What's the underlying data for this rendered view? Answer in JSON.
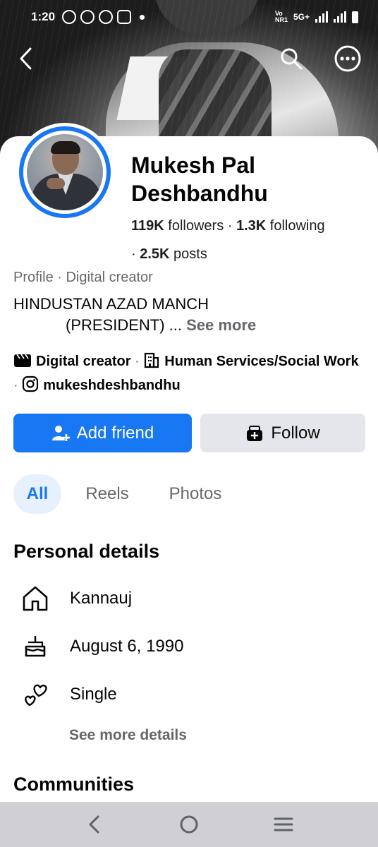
{
  "status_bar": {
    "time": "1:20",
    "network": "5G+"
  },
  "profile": {
    "name_line1": "Mukesh Pal",
    "name_line2": "Deshbandhu",
    "followers_count": "119K",
    "followers_label": " followers · ",
    "following_count": "1.3K",
    "following_label": " following",
    "posts_prefix": "· ",
    "posts_count": "2.5K",
    "posts_label": " posts",
    "profile_type": "Profile · Digital creator",
    "bio_line1": "HINDUSTAN AZAD MANCH",
    "bio_line2": "(PRESIDENT) ... ",
    "bio_see_more": "See more",
    "category1": "Digital creator",
    "category2": "Human Services/Social Work",
    "instagram": "mukeshdeshbandhu",
    "separator": " · "
  },
  "actions": {
    "add_friend": "Add friend",
    "follow": "Follow"
  },
  "tabs": [
    {
      "label": "All",
      "active": true
    },
    {
      "label": "Reels",
      "active": false
    },
    {
      "label": "Photos",
      "active": false
    }
  ],
  "personal_details": {
    "title": "Personal details",
    "hometown": "Kannauj",
    "birthday": "August 6, 1990",
    "relationship": "Single",
    "see_more": "See more details"
  },
  "communities": {
    "title": "Communities"
  },
  "icons": {
    "back": "back-arrow-icon",
    "search": "search-icon",
    "more": "more-options-icon",
    "home": "home-icon",
    "cake": "cake-icon",
    "hearts": "hearts-icon"
  },
  "colors": {
    "accent": "#1877f2",
    "secondary_button": "#e4e6eb",
    "muted_text": "#65676b",
    "active_tab_bg": "#e7f0fd"
  }
}
